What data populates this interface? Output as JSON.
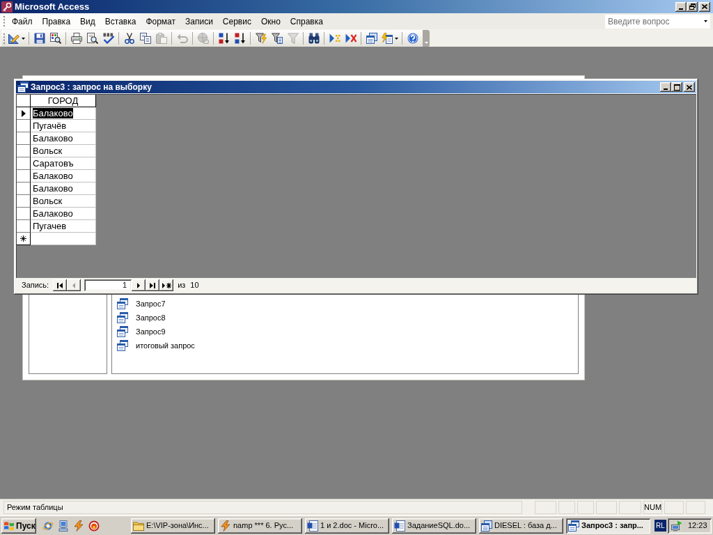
{
  "app_window": {
    "title": "Microsoft Access"
  },
  "menu_bar": {
    "items": [
      "Файл",
      "Правка",
      "Вид",
      "Вставка",
      "Формат",
      "Записи",
      "Сервис",
      "Окно",
      "Справка"
    ],
    "help_search": {
      "placeholder": "Введите вопрос"
    }
  },
  "toolbar": {
    "groups": [
      [
        {
          "kind": "design_view",
          "disabled": false
        }
      ],
      [
        {
          "kind": "save",
          "disabled": false
        },
        {
          "kind": "file_search",
          "disabled": false
        }
      ],
      [
        {
          "kind": "print",
          "disabled": false
        },
        {
          "kind": "print_preview",
          "disabled": false
        },
        {
          "kind": "spelling",
          "disabled": false
        }
      ],
      [
        {
          "kind": "cut",
          "disabled": false
        },
        {
          "kind": "copy",
          "disabled": false
        },
        {
          "kind": "paste",
          "disabled": true
        }
      ],
      [
        {
          "kind": "undo",
          "disabled": true
        }
      ],
      [
        {
          "kind": "hyperlink",
          "disabled": true
        }
      ],
      [
        {
          "kind": "sort_ascending",
          "disabled": false
        },
        {
          "kind": "sort_descending",
          "disabled": false
        }
      ],
      [
        {
          "kind": "filter_selection",
          "disabled": false
        },
        {
          "kind": "filter_form",
          "disabled": false
        },
        {
          "kind": "apply_filter",
          "disabled": true
        }
      ],
      [
        {
          "kind": "find",
          "disabled": false
        }
      ],
      [
        {
          "kind": "new_record",
          "disabled": false
        },
        {
          "kind": "delete_record",
          "disabled": false
        }
      ],
      [
        {
          "kind": "database_window",
          "disabled": false
        },
        {
          "kind": "new_object",
          "disabled": false
        }
      ],
      [
        {
          "kind": "help",
          "disabled": false
        }
      ]
    ]
  },
  "database_window": {
    "objects": [
      "Запрос7",
      "Запрос8",
      "Запрос9",
      "итоговый запрос"
    ]
  },
  "query_window": {
    "title": "Запрос3 : запрос на выборку",
    "datasheet": {
      "column": "ГОРОД",
      "rows": [
        {
          "value": "Балаково",
          "selected": true
        },
        {
          "value": "Пугачёв",
          "selected": false
        },
        {
          "value": "Балаково",
          "selected": false
        },
        {
          "value": "Вольск",
          "selected": false
        },
        {
          "value": "Саратовъ",
          "selected": false
        },
        {
          "value": "Балаково",
          "selected": false
        },
        {
          "value": "Балаково",
          "selected": false
        },
        {
          "value": "Вольск",
          "selected": false
        },
        {
          "value": "Балаково",
          "selected": false
        },
        {
          "value": "Пугачев",
          "selected": false
        }
      ]
    },
    "record_navigator": {
      "label": "Запись:",
      "buttons_before": [
        {
          "kind": "first",
          "disabled": false
        },
        {
          "kind": "previous",
          "disabled": true
        }
      ],
      "current": "1",
      "buttons_after": [
        {
          "kind": "next",
          "disabled": false
        },
        {
          "kind": "last",
          "disabled": false
        },
        {
          "kind": "new",
          "disabled": false
        }
      ],
      "of_label": "из",
      "count": "10"
    }
  },
  "status_bar": {
    "text": "Режим таблицы",
    "num_lock": "NUM"
  },
  "taskbar": {
    "start": "Пуск",
    "quick_launch": [
      {
        "kind": "browser"
      },
      {
        "kind": "computer"
      },
      {
        "kind": "player"
      },
      {
        "kind": "media"
      }
    ],
    "tasks": [
      {
        "kind": "folder",
        "label": "E:\\VIP-зона\\Инс...",
        "selected": false
      },
      {
        "kind": "player",
        "label": "namp *** 6. Рус...",
        "selected": false
      },
      {
        "kind": "document",
        "label": "1 и 2.doc - Micro...",
        "selected": false
      },
      {
        "kind": "document",
        "label": "ЗаданиеSQL.do...",
        "selected": false
      },
      {
        "kind": "database",
        "label": "DIESEL : база д...",
        "selected": false
      },
      {
        "kind": "query",
        "label": "Запрос3 : запр...",
        "selected": true
      }
    ],
    "language": "RL",
    "clock": "12:23"
  }
}
